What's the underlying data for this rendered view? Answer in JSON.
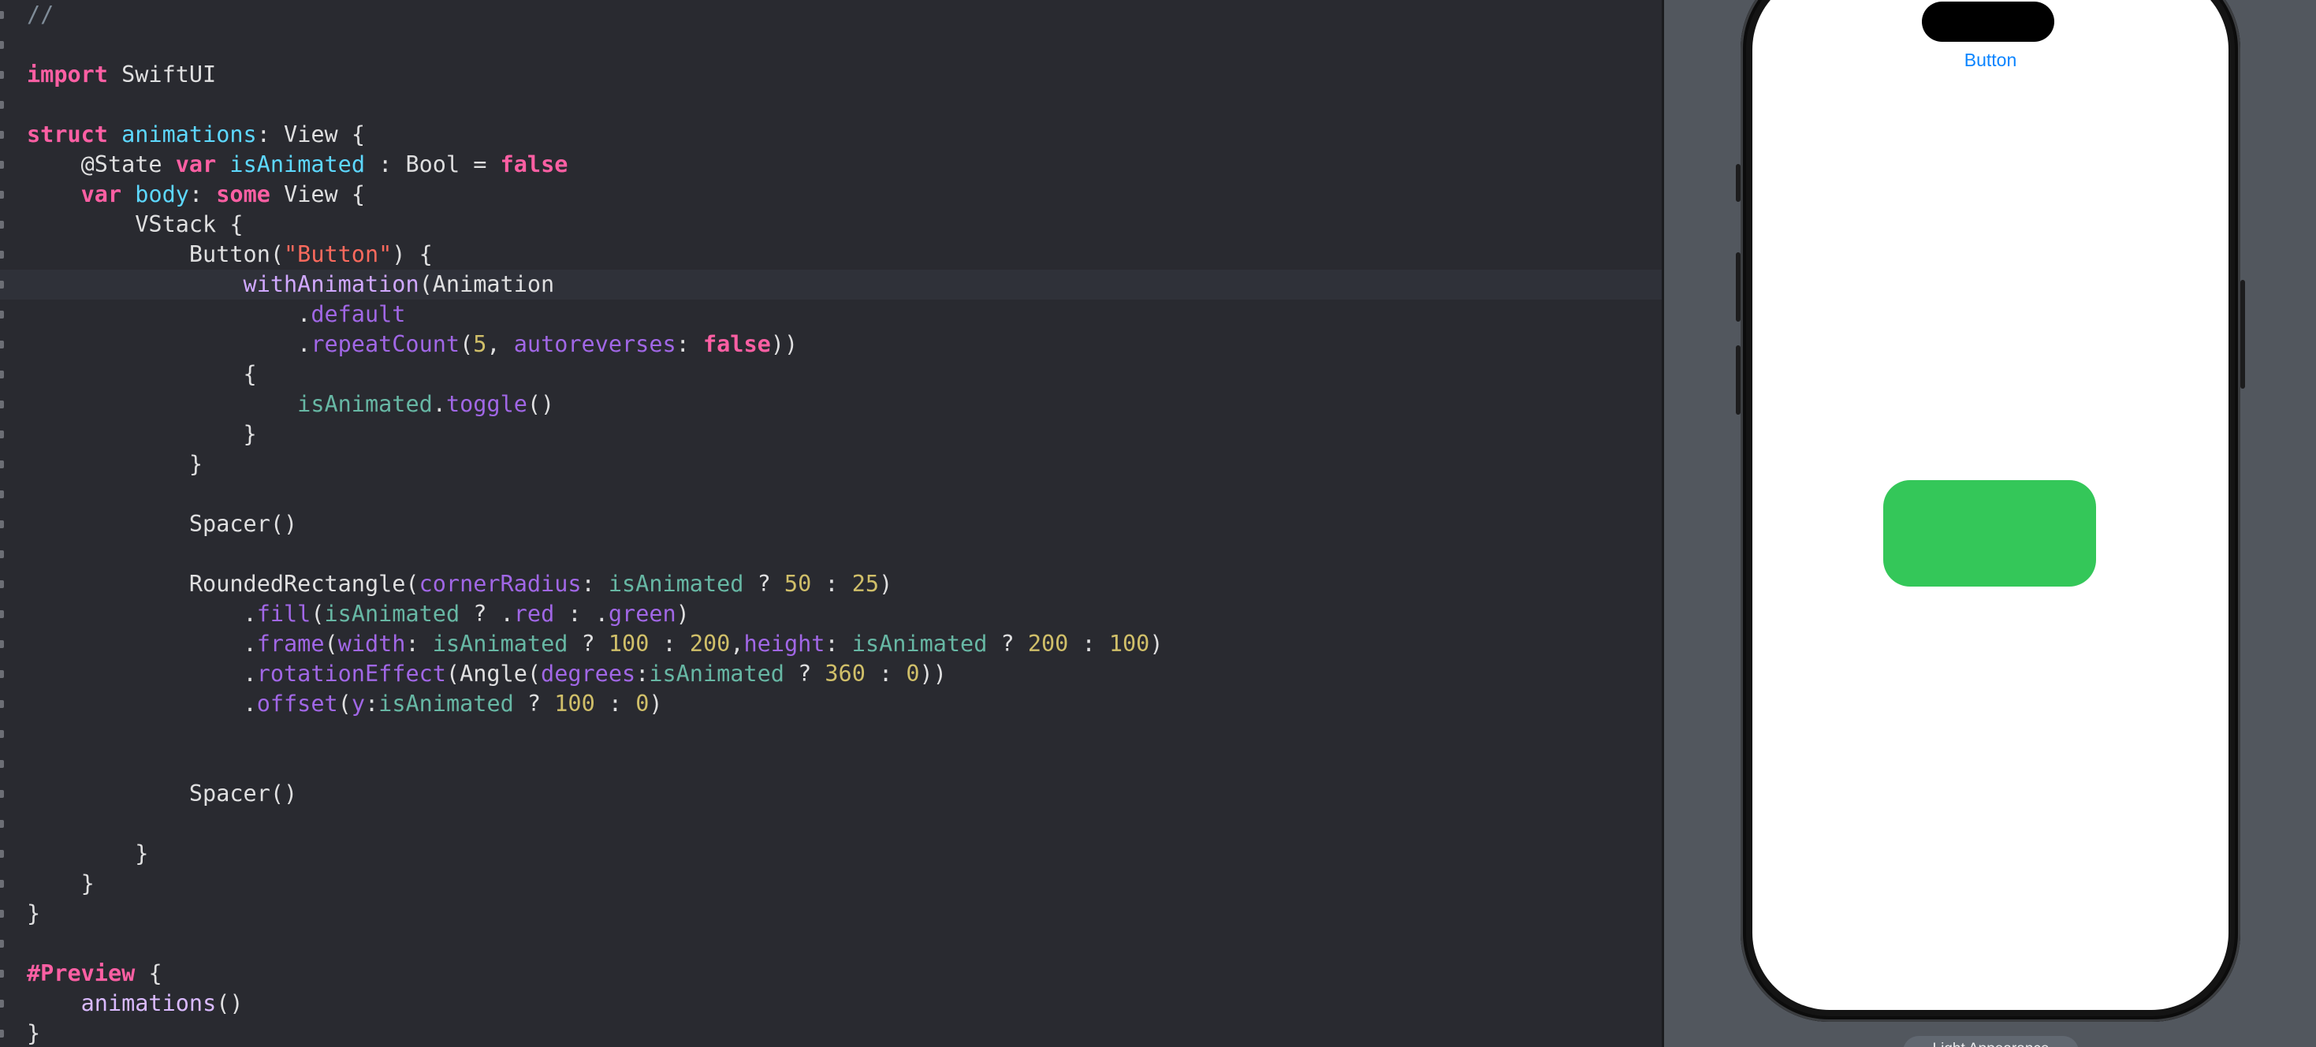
{
  "editor": {
    "lines": [
      [
        [
          "cm",
          "//"
        ]
      ],
      [],
      [
        [
          "kw",
          "import"
        ],
        [
          "plain",
          " SwiftUI"
        ]
      ],
      [],
      [
        [
          "kw",
          "struct"
        ],
        [
          "plain",
          " "
        ],
        [
          "type",
          "animations"
        ],
        [
          "plain",
          ": View {"
        ]
      ],
      [
        [
          "plain",
          "    @State "
        ],
        [
          "kw",
          "var"
        ],
        [
          "plain",
          " "
        ],
        [
          "type",
          "isAnimated"
        ],
        [
          "plain",
          " : Bool = "
        ],
        [
          "kw",
          "false"
        ]
      ],
      [
        [
          "plain",
          "    "
        ],
        [
          "kw",
          "var"
        ],
        [
          "plain",
          " "
        ],
        [
          "type",
          "body"
        ],
        [
          "plain",
          ": "
        ],
        [
          "kw",
          "some"
        ],
        [
          "plain",
          " View {"
        ]
      ],
      [
        [
          "plain",
          "        VStack {"
        ]
      ],
      [
        [
          "plain",
          "            Button("
        ],
        [
          "str",
          "\"Button\""
        ],
        [
          "plain",
          ") {"
        ]
      ],
      [
        [
          "plain",
          "                "
        ],
        [
          "sys",
          "withAnimation"
        ],
        [
          "plain",
          "(Animation"
        ]
      ],
      [
        [
          "plain",
          "                    ."
        ],
        [
          "prop",
          "default"
        ]
      ],
      [
        [
          "plain",
          "                    ."
        ],
        [
          "prop",
          "repeatCount"
        ],
        [
          "plain",
          "("
        ],
        [
          "num",
          "5"
        ],
        [
          "plain",
          ", "
        ],
        [
          "prop",
          "autoreverses"
        ],
        [
          "plain",
          ": "
        ],
        [
          "kw",
          "false"
        ],
        [
          "plain",
          "))"
        ]
      ],
      [
        [
          "plain",
          "                {"
        ]
      ],
      [
        [
          "plain",
          "                    "
        ],
        [
          "func",
          "isAnimated"
        ],
        [
          "plain",
          "."
        ],
        [
          "prop",
          "toggle"
        ],
        [
          "plain",
          "()"
        ]
      ],
      [
        [
          "plain",
          "                }"
        ]
      ],
      [
        [
          "plain",
          "            }"
        ]
      ],
      [],
      [
        [
          "plain",
          "            Spacer()"
        ]
      ],
      [],
      [
        [
          "plain",
          "            RoundedRectangle("
        ],
        [
          "prop",
          "cornerRadius"
        ],
        [
          "plain",
          ": "
        ],
        [
          "func",
          "isAnimated"
        ],
        [
          "plain",
          " ? "
        ],
        [
          "num",
          "50"
        ],
        [
          "plain",
          " : "
        ],
        [
          "num",
          "25"
        ],
        [
          "plain",
          ")"
        ]
      ],
      [
        [
          "plain",
          "                ."
        ],
        [
          "prop",
          "fill"
        ],
        [
          "plain",
          "("
        ],
        [
          "func",
          "isAnimated"
        ],
        [
          "plain",
          " ? ."
        ],
        [
          "prop",
          "red"
        ],
        [
          "plain",
          " : ."
        ],
        [
          "prop",
          "green"
        ],
        [
          "plain",
          ")"
        ]
      ],
      [
        [
          "plain",
          "                ."
        ],
        [
          "prop",
          "frame"
        ],
        [
          "plain",
          "("
        ],
        [
          "prop",
          "width"
        ],
        [
          "plain",
          ": "
        ],
        [
          "func",
          "isAnimated"
        ],
        [
          "plain",
          " ? "
        ],
        [
          "num",
          "100"
        ],
        [
          "plain",
          " : "
        ],
        [
          "num",
          "200"
        ],
        [
          "plain",
          ","
        ],
        [
          "prop",
          "height"
        ],
        [
          "plain",
          ": "
        ],
        [
          "func",
          "isAnimated"
        ],
        [
          "plain",
          " ? "
        ],
        [
          "num",
          "200"
        ],
        [
          "plain",
          " : "
        ],
        [
          "num",
          "100"
        ],
        [
          "plain",
          ")"
        ]
      ],
      [
        [
          "plain",
          "                ."
        ],
        [
          "prop",
          "rotationEffect"
        ],
        [
          "plain",
          "(Angle("
        ],
        [
          "prop",
          "degrees"
        ],
        [
          "plain",
          ":"
        ],
        [
          "func",
          "isAnimated"
        ],
        [
          "plain",
          " ? "
        ],
        [
          "num",
          "360"
        ],
        [
          "plain",
          " : "
        ],
        [
          "num",
          "0"
        ],
        [
          "plain",
          "))"
        ]
      ],
      [
        [
          "plain",
          "                ."
        ],
        [
          "prop",
          "offset"
        ],
        [
          "plain",
          "("
        ],
        [
          "prop",
          "y"
        ],
        [
          "plain",
          ":"
        ],
        [
          "func",
          "isAnimated"
        ],
        [
          "plain",
          " ? "
        ],
        [
          "num",
          "100"
        ],
        [
          "plain",
          " : "
        ],
        [
          "num",
          "0"
        ],
        [
          "plain",
          ")"
        ]
      ],
      [],
      [],
      [
        [
          "plain",
          "            Spacer()"
        ]
      ],
      [],
      [
        [
          "plain",
          "        }"
        ]
      ],
      [
        [
          "plain",
          "    }"
        ]
      ],
      [
        [
          "plain",
          "}"
        ]
      ],
      [],
      [
        [
          "kw",
          "#Preview"
        ],
        [
          "plain",
          " {"
        ]
      ],
      [
        [
          "plain",
          "    "
        ],
        [
          "cls",
          "animations"
        ],
        [
          "plain",
          "()"
        ]
      ],
      [
        [
          "plain",
          "}"
        ]
      ]
    ]
  },
  "preview": {
    "button_label": "Button",
    "appearance_label": "Light Appearance",
    "shape_color": "#34c759",
    "button_color": "#0a84ff"
  },
  "colors": {
    "editor_bg": "#292a30",
    "canvas_bg": "#52575e",
    "keyword": "#fc5fa3",
    "string": "#fc6a5d",
    "number": "#d0bf69",
    "type": "#5dd8ff",
    "property": "#a167e6"
  }
}
